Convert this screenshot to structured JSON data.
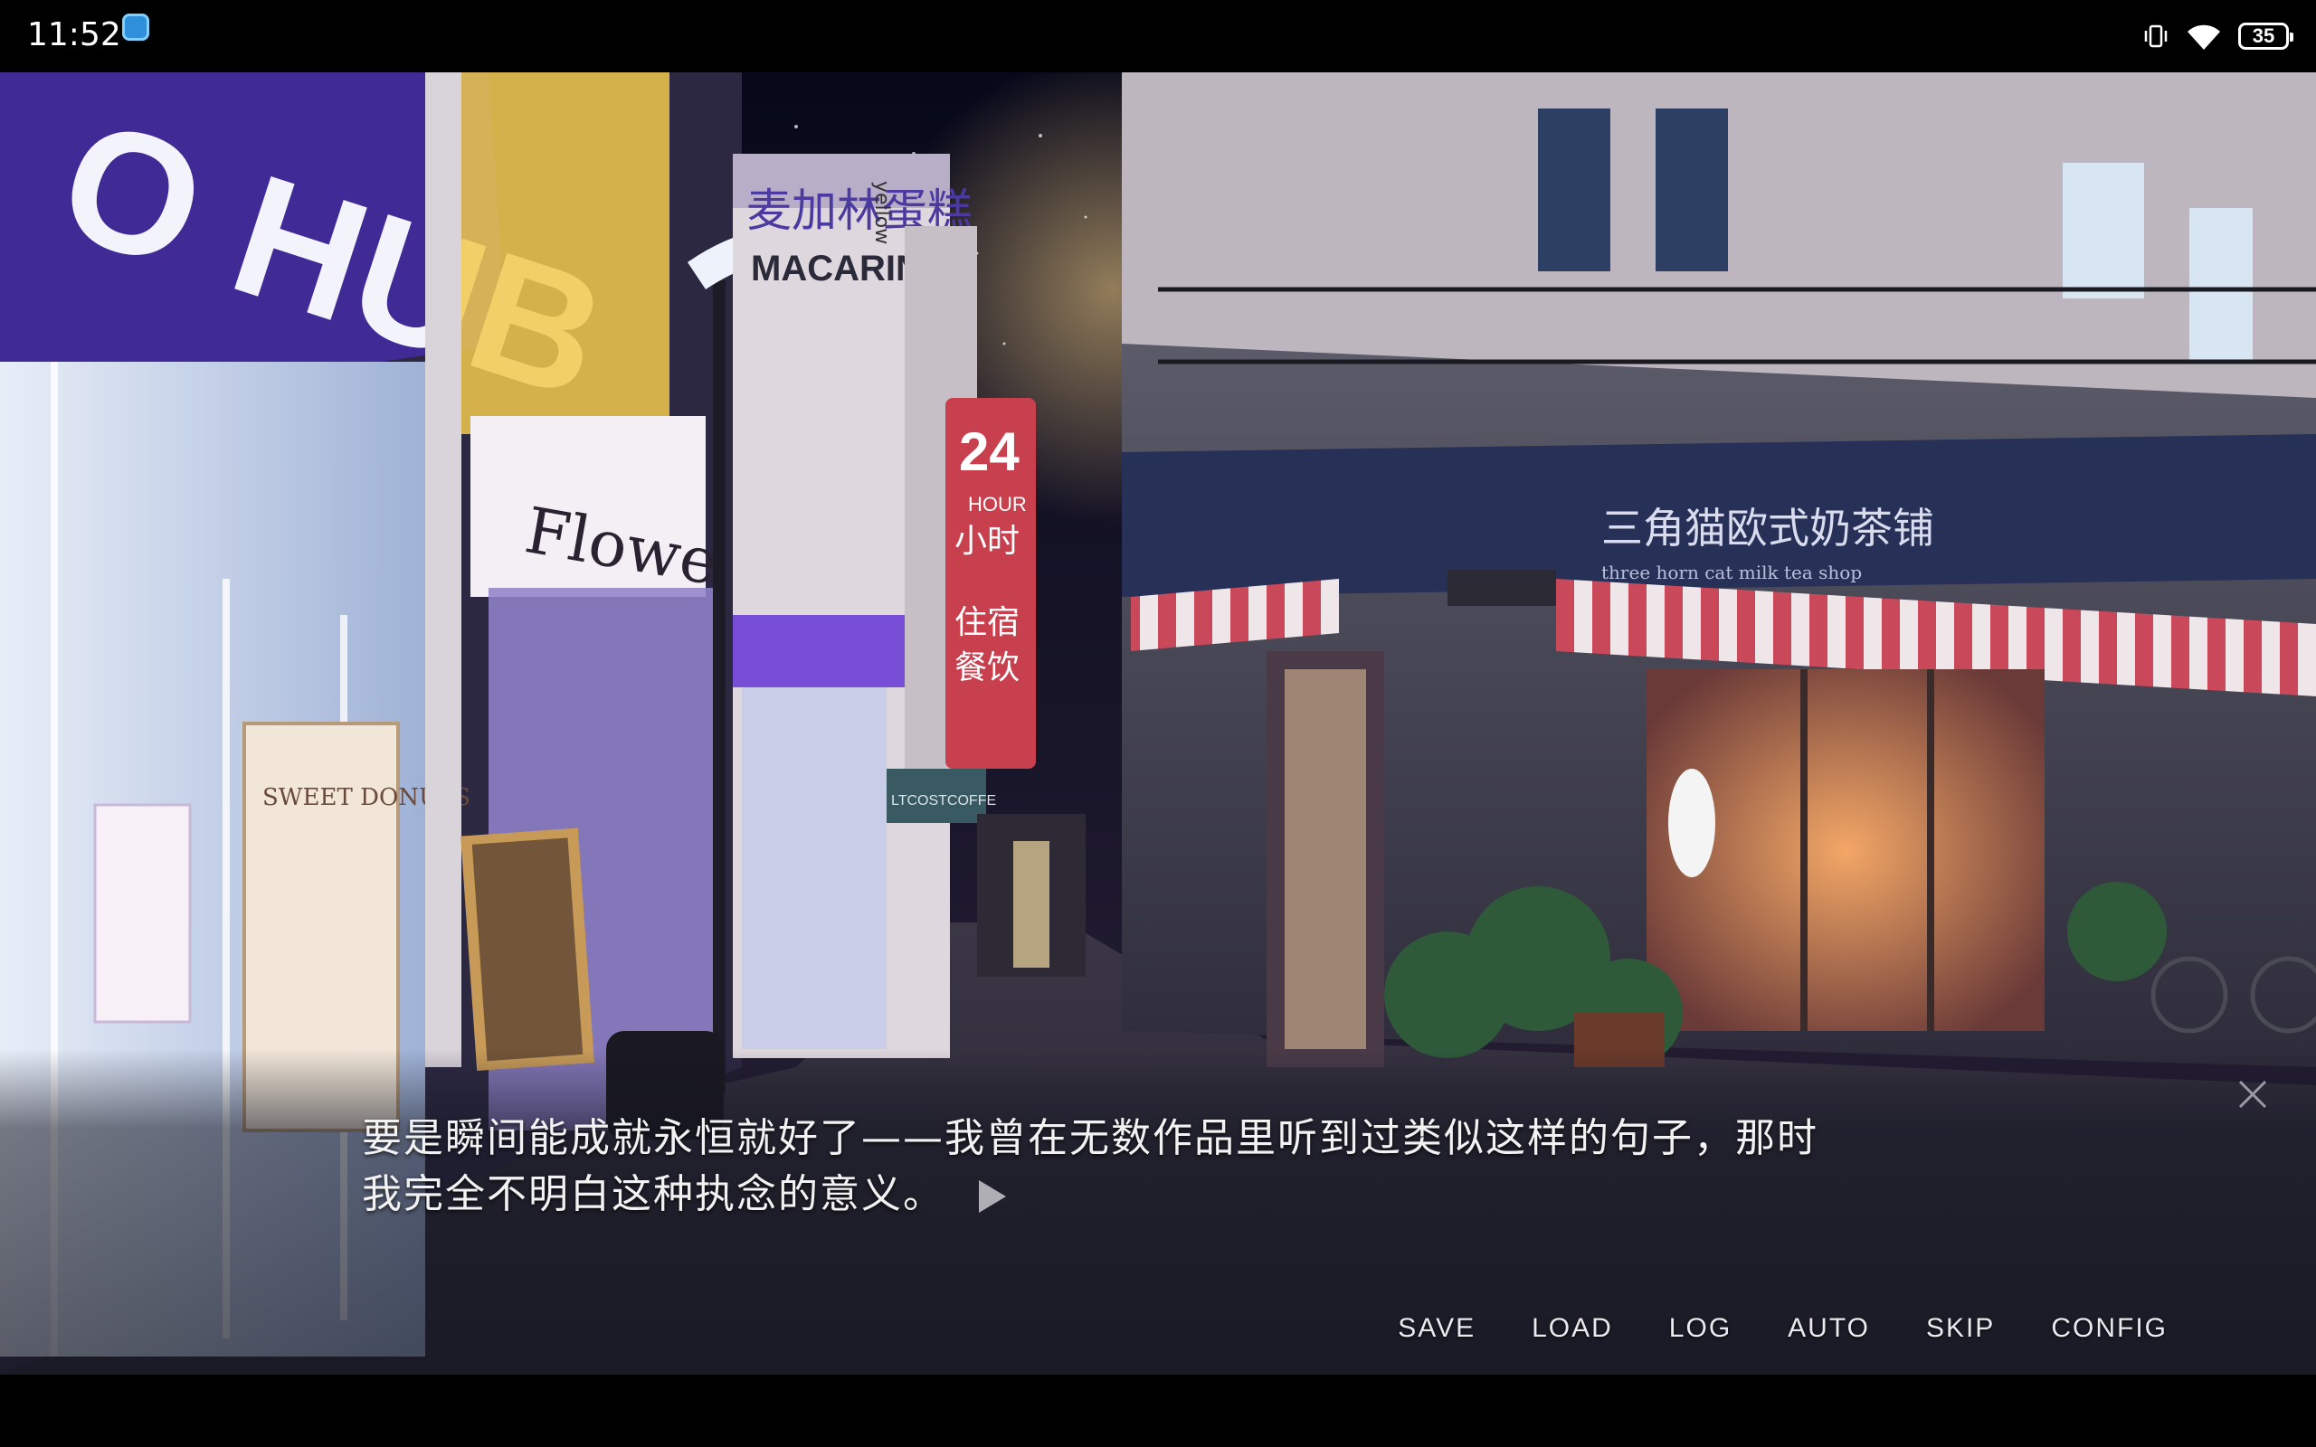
{
  "status_bar": {
    "time": "11:52",
    "battery": "35",
    "icons": [
      "app-icon",
      "vibrate-icon",
      "wifi-icon",
      "battery-icon"
    ]
  },
  "scene": {
    "signs": {
      "hub": "O HUB",
      "flower": "Flowe",
      "macarine_cn": "麦加林蛋糕",
      "macarine_en": "MACARINE",
      "hour_num": "24",
      "hour_en": "HOUR",
      "hour_cn": "小时",
      "inn_1": "住宿",
      "inn_2": "餐饮",
      "sweet": "SWEET DONUTS",
      "teashop_cn": "三角猫欧式奶茶铺",
      "teashop_en": "three horn cat milk tea shop",
      "cafe": "LTCOSTCOFFE",
      "yellow": "yellow"
    }
  },
  "dialogue": {
    "line1": "要是瞬间能成就永恒就好了——我曾在无数作品里听到过类似这样的句子，那时",
    "line2": "我完全不明白这种执念的意义。"
  },
  "menu": {
    "save": "SAVE",
    "load": "LOAD",
    "log": "LOG",
    "auto": "AUTO",
    "skip": "SKIP",
    "config": "CONFIG"
  },
  "colors": {
    "sky": "#0e1022",
    "hub_sign": "#4a2fa8",
    "awning_red": "#c9495a",
    "textbox": "#141622"
  }
}
